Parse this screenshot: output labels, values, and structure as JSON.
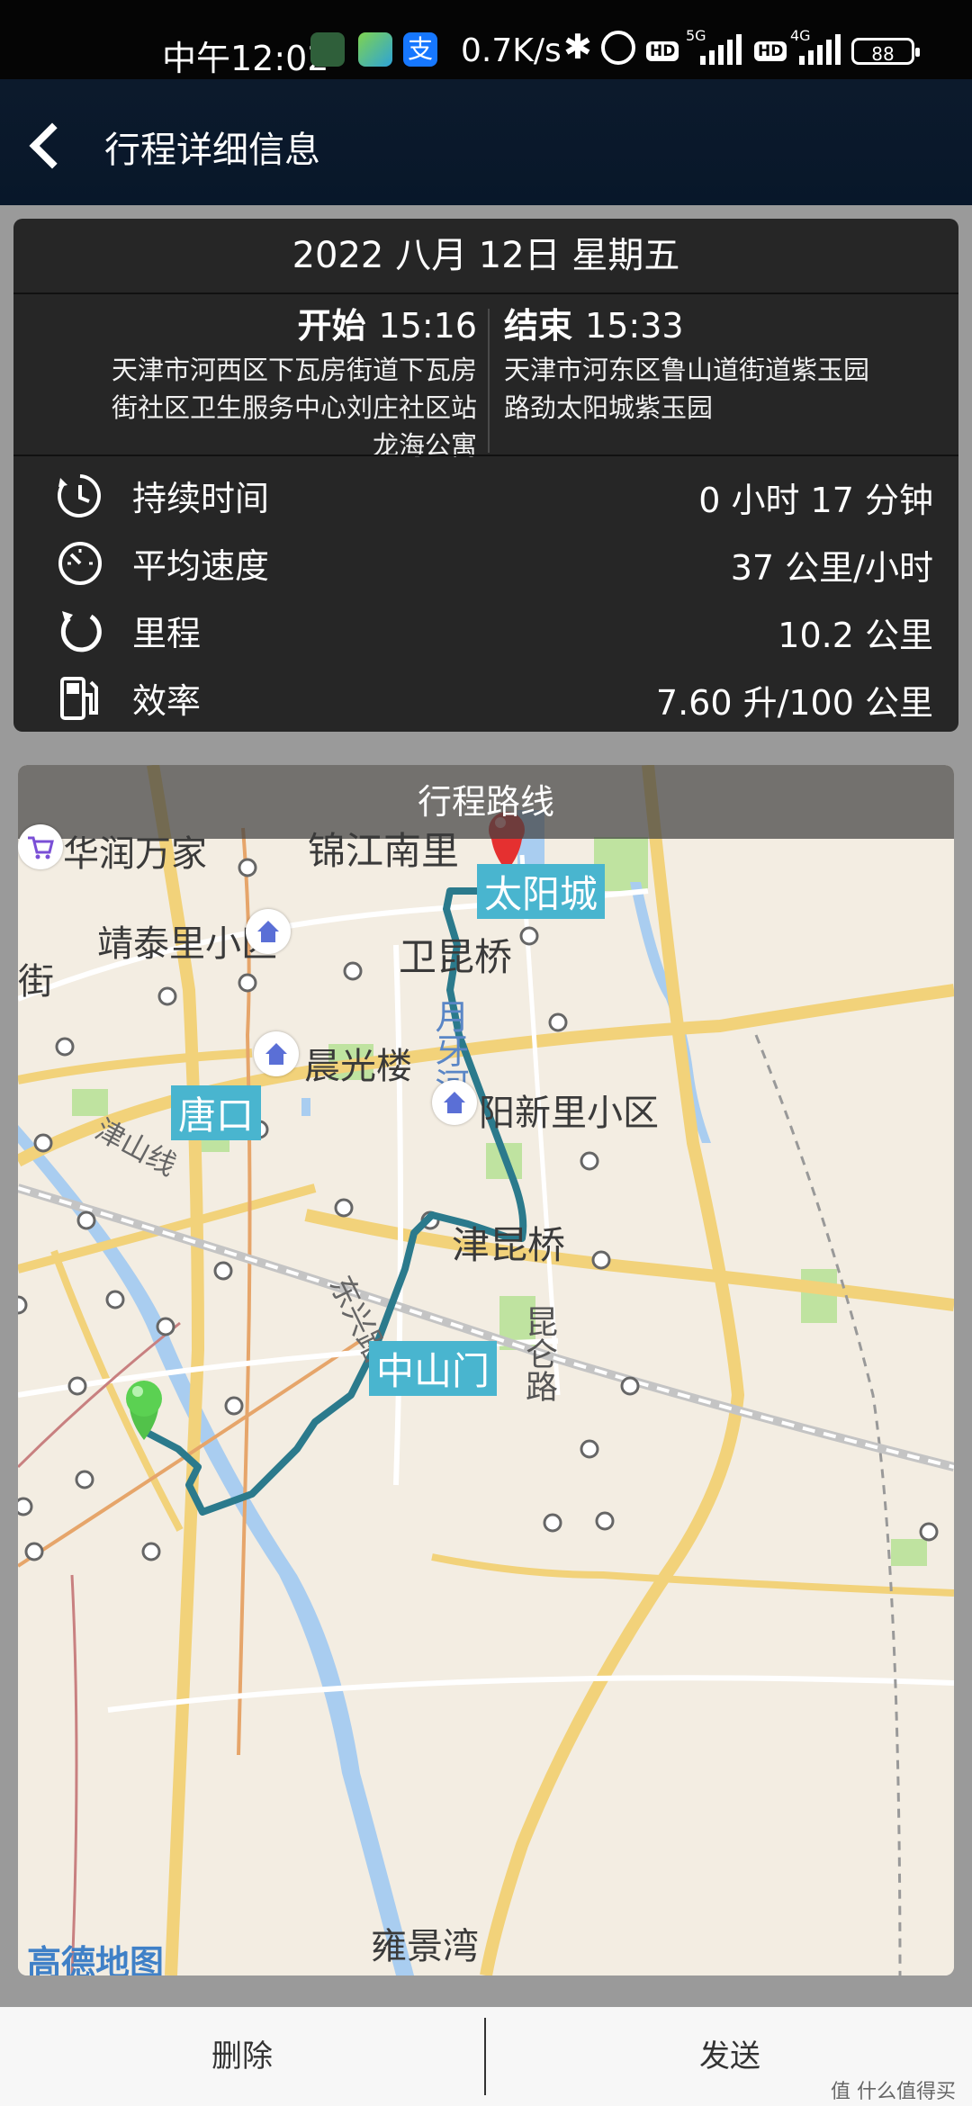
{
  "status_bar": {
    "time": "中午12:02",
    "net_speed": "0.7K/s",
    "sim1": {
      "hd": "HD",
      "net": "5G"
    },
    "sim2": {
      "hd": "HD",
      "net": "4G"
    },
    "battery": "88",
    "app_icons": [
      "remote-app-icon",
      "game-app-icon",
      "alipay-icon"
    ],
    "alipay_glyph": "支"
  },
  "header": {
    "title": "行程详细信息"
  },
  "trip": {
    "date": "2022 八月 12日 星期五",
    "start": {
      "label": "开始",
      "time": "15:16",
      "address_lines": [
        "天津市河西区下瓦房街道下瓦房",
        "街社区卫生服务中心刘庄社区站",
        "龙海公寓"
      ]
    },
    "end": {
      "label": "结束",
      "time": "15:33",
      "address_lines": [
        "天津市河东区鲁山道街道紫玉园",
        "路劲太阳城紫玉园"
      ]
    },
    "stats": [
      {
        "icon": "stopwatch-icon",
        "label": "持续时间",
        "value": "0 小时 17 分钟"
      },
      {
        "icon": "speedometer-icon",
        "label": "平均速度",
        "value": "37 公里/小时"
      },
      {
        "icon": "loop-icon",
        "label": "里程",
        "value": "10.2 公里"
      },
      {
        "icon": "fuel-icon",
        "label": "效率",
        "value": "7.60 升/100 公里"
      }
    ]
  },
  "map": {
    "title": "行程路线",
    "labels": {
      "huarun": "华润万家",
      "jinjiang": "锦江南里",
      "taiyangcheng": "太阳城",
      "jingtai": "靖泰里小区",
      "weikun": "卫昆桥",
      "chenguang": "晨光楼",
      "tangkou": "唐口",
      "yangxinli": "阳新里小区",
      "jinshan": "津山线",
      "jinkun": "津昆桥",
      "zhongshanmen": "中山门",
      "kunlun": "昆仑路",
      "yongjing": "雍景湾",
      "river": "月牙河",
      "jie": "街",
      "dongxing": "东兴路"
    },
    "watermark": "高德地图",
    "route_color": "#2b7a8c"
  },
  "actions": {
    "delete": "删除",
    "send": "发送"
  },
  "footer_watermark": "值 什么值得买"
}
